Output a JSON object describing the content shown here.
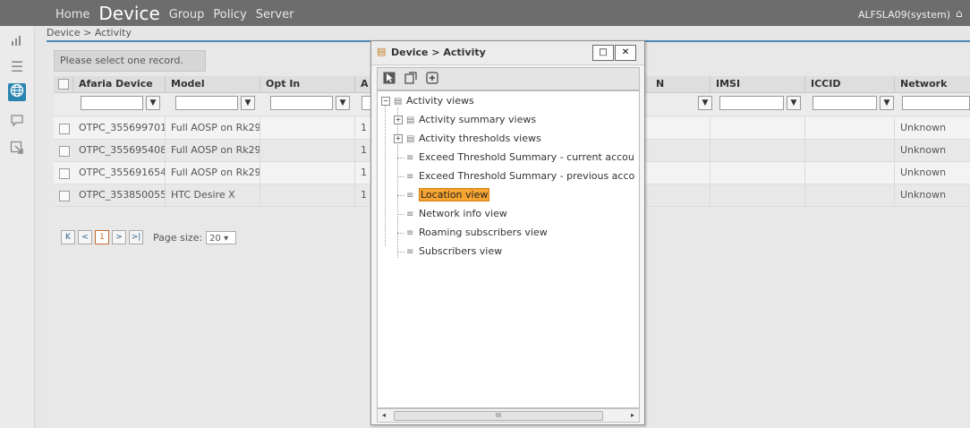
{
  "nav": {
    "items": [
      "Home",
      "Device",
      "Group",
      "Policy",
      "Server"
    ],
    "active": "Device",
    "user": "ALFSLA09(system)"
  },
  "breadcrumb": "Device > Activity",
  "select_message": "Please select one record.",
  "grid": {
    "columns": [
      "Afaria Device ID",
      "Model",
      "Opt In",
      "A",
      "N",
      "IMSI",
      "ICCID",
      "Network Name"
    ],
    "rows": [
      {
        "id": "OTPC_355699701",
        "model": "Full AOSP on Rk29",
        "optin": "",
        "a": "1",
        "n": "",
        "imsi": "",
        "iccid": "",
        "network": "Unknown"
      },
      {
        "id": "OTPC_355695408",
        "model": "Full AOSP on Rk29",
        "optin": "",
        "a": "1",
        "n": "",
        "imsi": "",
        "iccid": "",
        "network": "Unknown"
      },
      {
        "id": "OTPC_355691654",
        "model": "Full AOSP on Rk29",
        "optin": "",
        "a": "1",
        "n": "",
        "imsi": "",
        "iccid": "",
        "network": "Unknown"
      },
      {
        "id": "OTPC_353850055",
        "model": "HTC Desire X",
        "optin": "",
        "a": "1",
        "n": "",
        "imsi": "",
        "iccid": "",
        "network": "Unknown"
      }
    ]
  },
  "pager": {
    "current_page": "1",
    "page_size_label": "Page size:",
    "page_size": "20"
  },
  "dialog": {
    "title": "Device > Activity",
    "tree": {
      "root": "Activity views",
      "children": [
        "Activity summary views",
        "Activity thresholds views",
        "Exceed Threshold Summary - current accou",
        "Exceed Threshold Summary - previous acco",
        "Location view",
        "Network info view",
        "Roaming subscribers view",
        "Subscribers view"
      ],
      "selected": "Location view"
    },
    "scroll_thumb": "III"
  }
}
